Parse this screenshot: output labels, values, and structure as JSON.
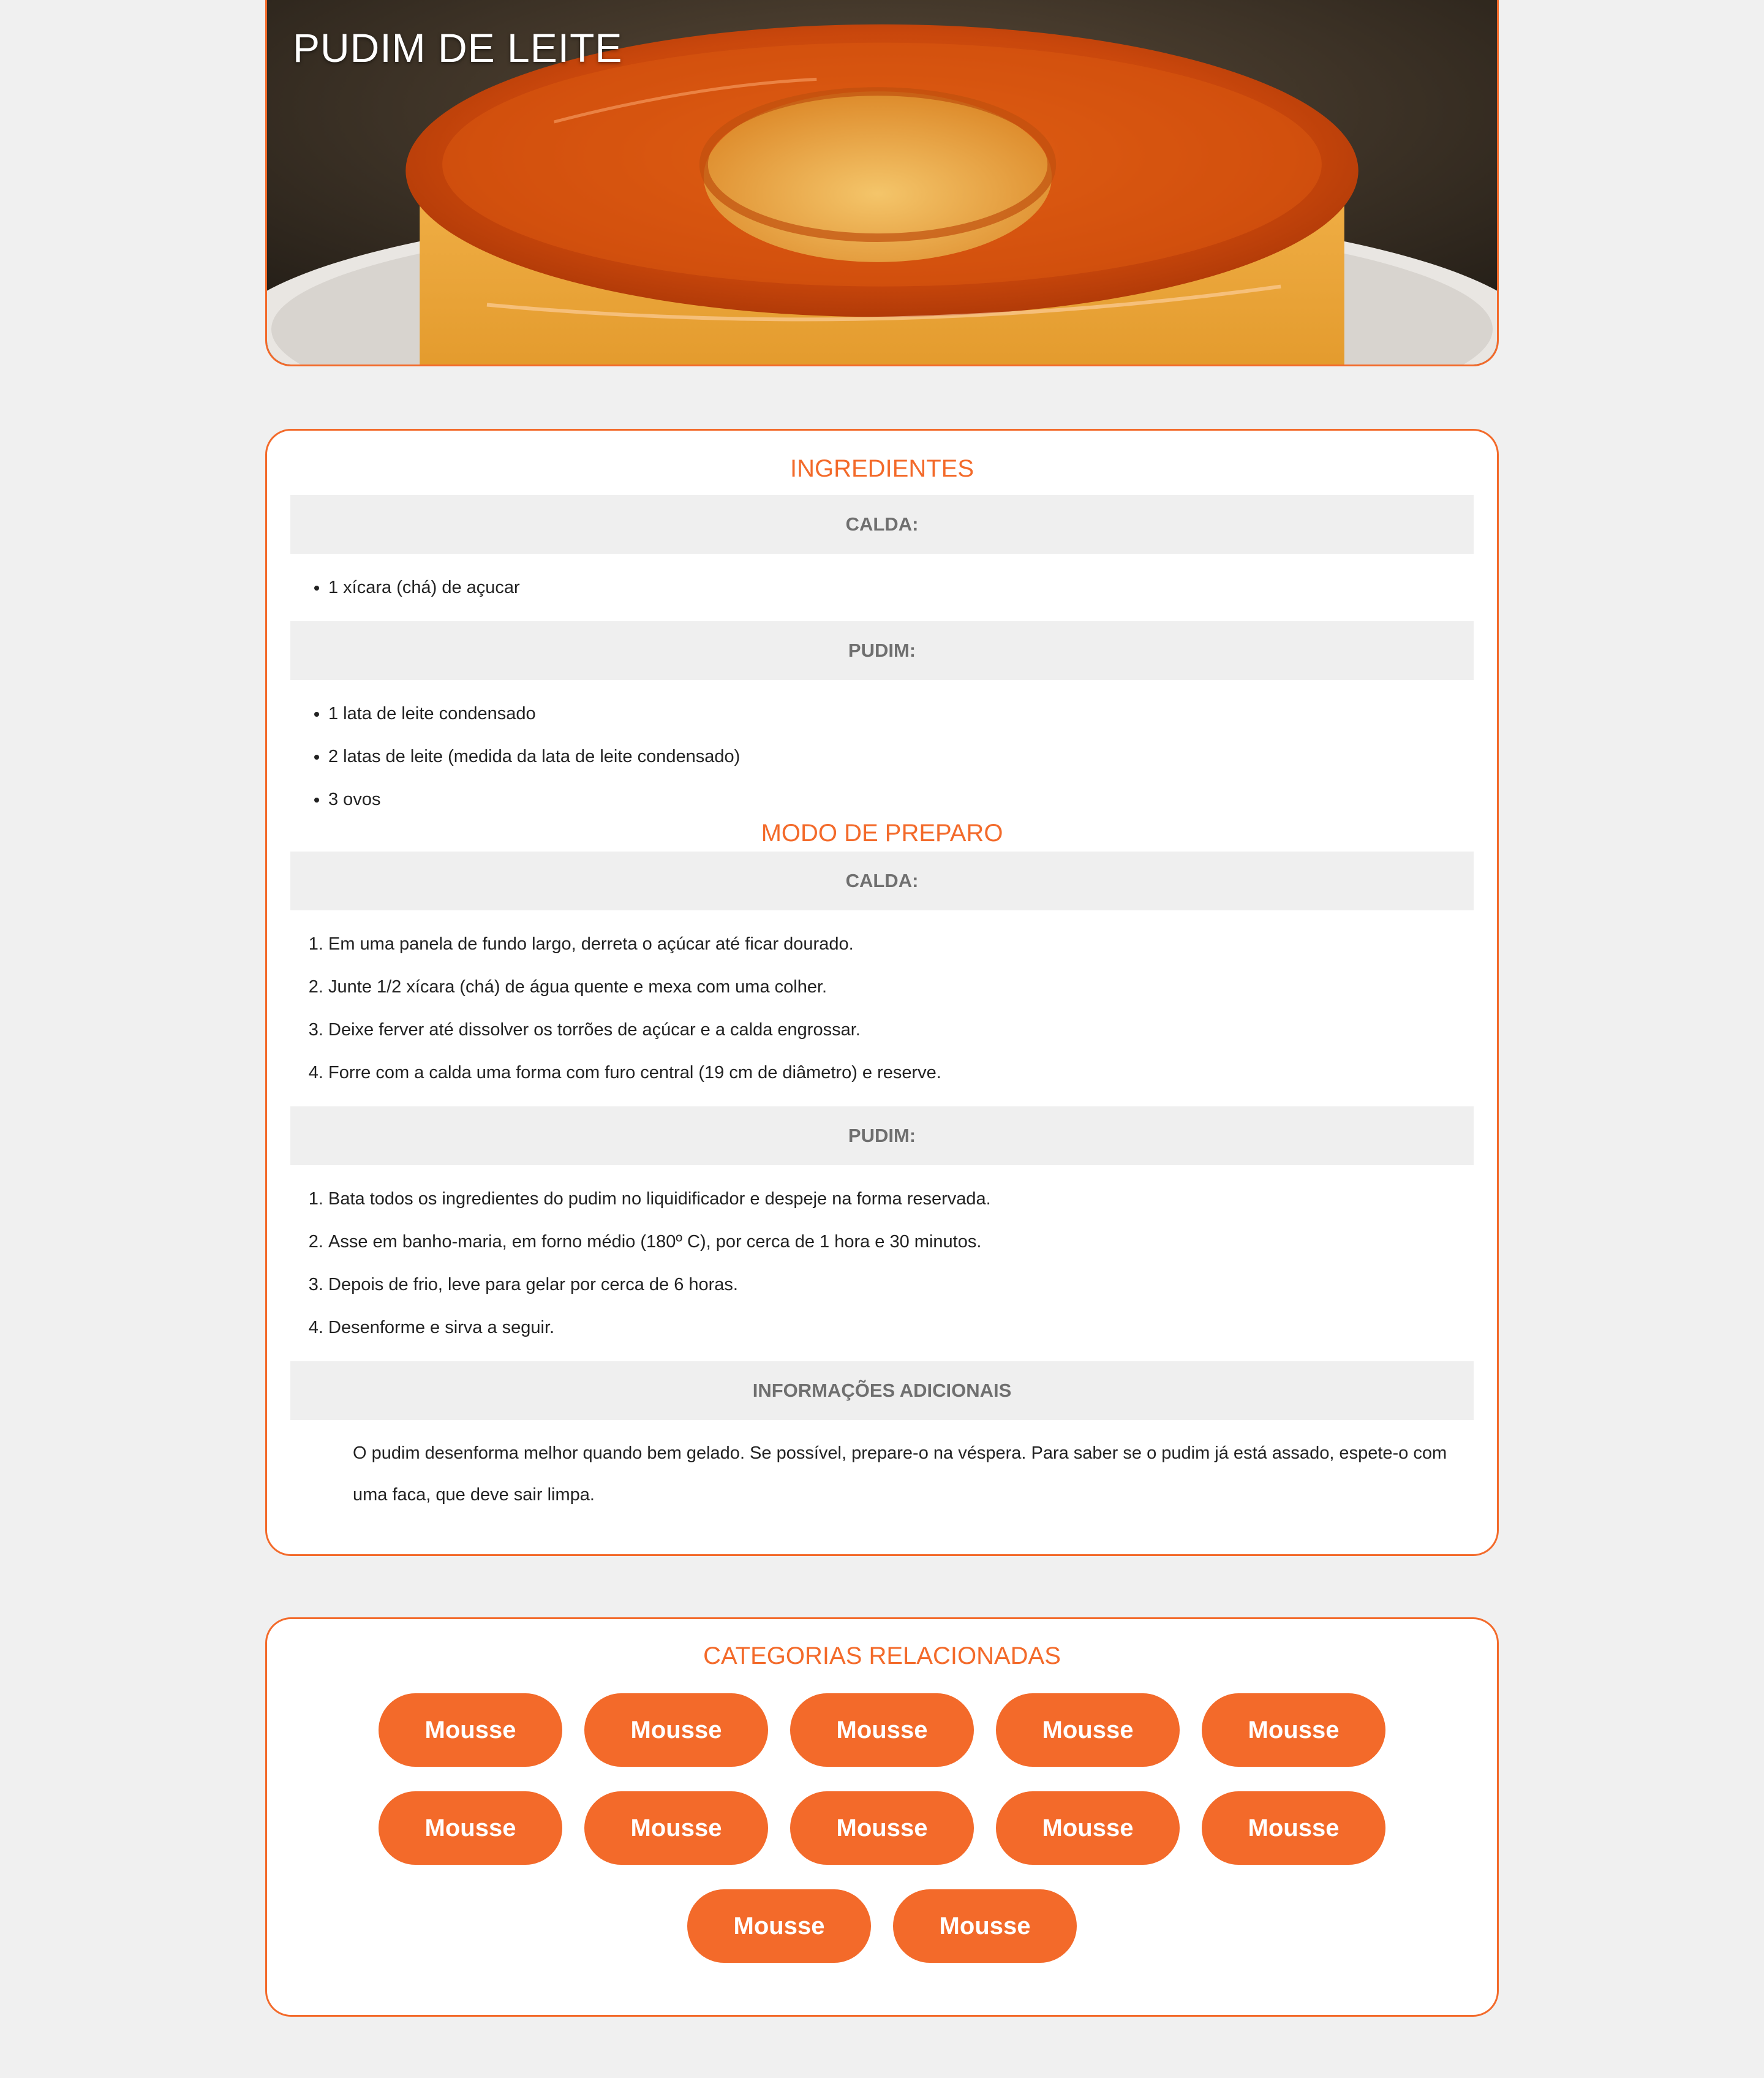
{
  "hero": {
    "title": "PUDIM DE LEITE"
  },
  "ingredientes": {
    "title": "INGREDIENTES",
    "calda": {
      "label": "CALDA:",
      "items": [
        "1 xícara (chá) de açucar"
      ]
    },
    "pudim": {
      "label": "PUDIM:",
      "items": [
        "1 lata de leite condensado",
        "2 latas de leite (medida da lata de leite condensado)",
        "3 ovos"
      ]
    }
  },
  "preparo": {
    "title": "MODO DE PREPARO",
    "calda": {
      "label": "CALDA:",
      "steps": [
        "Em uma panela de fundo largo, derreta o açúcar até ficar dourado.",
        "Junte 1/2 xícara (chá) de água quente e mexa com uma colher.",
        "Deixe ferver até dissolver os torrões de açúcar e a calda engrossar.",
        "Forre com a calda uma forma com furo central (19 cm de diâmetro) e reserve."
      ]
    },
    "pudim": {
      "label": "PUDIM:",
      "steps": [
        "Bata todos os ingredientes do pudim no liquidificador e despeje na forma reservada.",
        "Asse em banho-maria, em forno médio (180º C), por cerca de 1 hora e 30 minutos.",
        "Depois de frio, leve para gelar por cerca de 6 horas.",
        "Desenforme e sirva a seguir."
      ]
    },
    "info": {
      "label": "INFORMAÇÕES ADICIONAIS",
      "text": "O pudim desenforma melhor quando bem gelado. Se possível, prepare-o na véspera. Para saber se o pudim já está assado, espete-o com uma faca, que deve sair limpa."
    }
  },
  "related": {
    "title": "CATEGORIAS RELACIONADAS",
    "chips": [
      "Mousse",
      "Mousse",
      "Mousse",
      "Mousse",
      "Mousse",
      "Mousse",
      "Mousse",
      "Mousse",
      "Mousse",
      "Mousse",
      "Mousse",
      "Mousse"
    ]
  },
  "colors": {
    "accent": "#f36a2a",
    "bar": "#efefef",
    "background": "#f0f0f0"
  }
}
